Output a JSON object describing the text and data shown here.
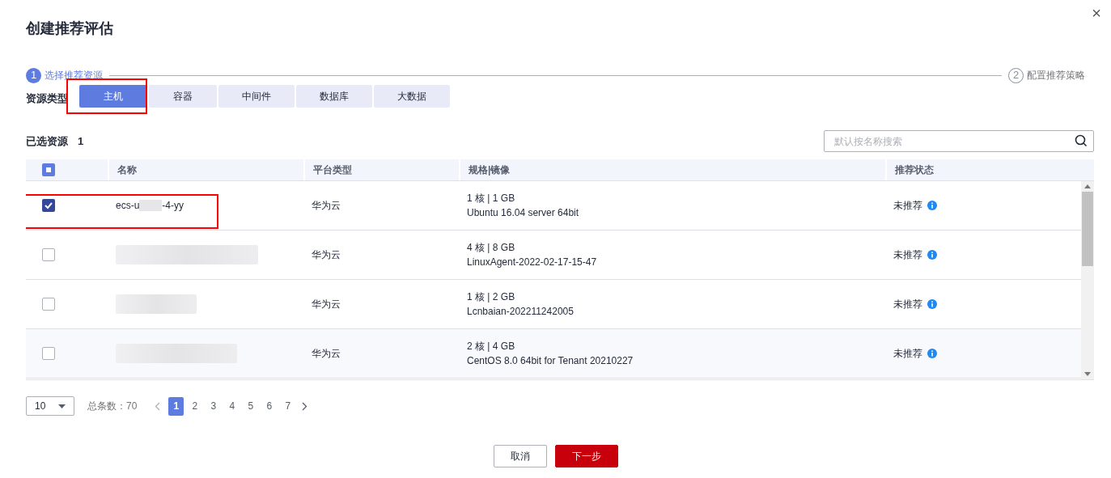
{
  "dialog": {
    "title": "创建推荐评估",
    "close": "×"
  },
  "steps": [
    {
      "number": "1",
      "label": "选择推荐资源",
      "selected": true
    },
    {
      "number": "2",
      "label": "配置推荐策略",
      "selected": false
    }
  ],
  "resource_type": {
    "label": "资源类型",
    "tabs": [
      {
        "label": "主机",
        "selected": true,
        "highlighted": true
      },
      {
        "label": "容器",
        "selected": false,
        "highlighted": false
      },
      {
        "label": "中间件",
        "selected": false,
        "highlighted": false
      },
      {
        "label": "数据库",
        "selected": false,
        "highlighted": false
      },
      {
        "label": "大数据",
        "selected": false,
        "highlighted": false
      }
    ]
  },
  "selected_count": {
    "label": "已选资源",
    "value": "1"
  },
  "search": {
    "placeholder": "默认按名称搜索"
  },
  "table": {
    "columns": [
      "名称",
      "平台类型",
      "规格|镜像",
      "推荐状态"
    ],
    "select_all_partial": true,
    "rows": [
      {
        "checked": true,
        "highlighted": true,
        "name_prefix": "ecs-u",
        "name_suffix": "-4-yy",
        "platform": "华为云",
        "spec": "1 核 | 1 GB",
        "image": "Ubuntu 16.04 server 64bit",
        "status": "未推荐"
      },
      {
        "checked": false,
        "highlighted": false,
        "platform": "华为云",
        "spec": "4 核 | 8 GB",
        "image": "LinuxAgent-2022-02-17-15-47",
        "status": "未推荐"
      },
      {
        "checked": false,
        "highlighted": false,
        "platform": "华为云",
        "spec": "1 核 | 2 GB",
        "image": "Lcnbaian-202211242005",
        "status": "未推荐"
      },
      {
        "checked": false,
        "highlighted": false,
        "platform": "华为云",
        "spec": "2 核 | 4 GB",
        "image": "CentOS 8.0 64bit for Tenant 20210227",
        "status": "未推荐"
      }
    ]
  },
  "pagination": {
    "page_size": "10",
    "total_label": "总条数：70",
    "pages": [
      {
        "label": "1",
        "selected": true
      },
      {
        "label": "2",
        "selected": false
      },
      {
        "label": "3",
        "selected": false
      },
      {
        "label": "4",
        "selected": false
      },
      {
        "label": "5",
        "selected": false
      },
      {
        "label": "6",
        "selected": false
      },
      {
        "label": "7",
        "selected": false
      }
    ]
  },
  "buttons": [
    {
      "label": "取消",
      "kind": "secondary"
    },
    {
      "label": "下一步",
      "kind": "primary"
    }
  ]
}
